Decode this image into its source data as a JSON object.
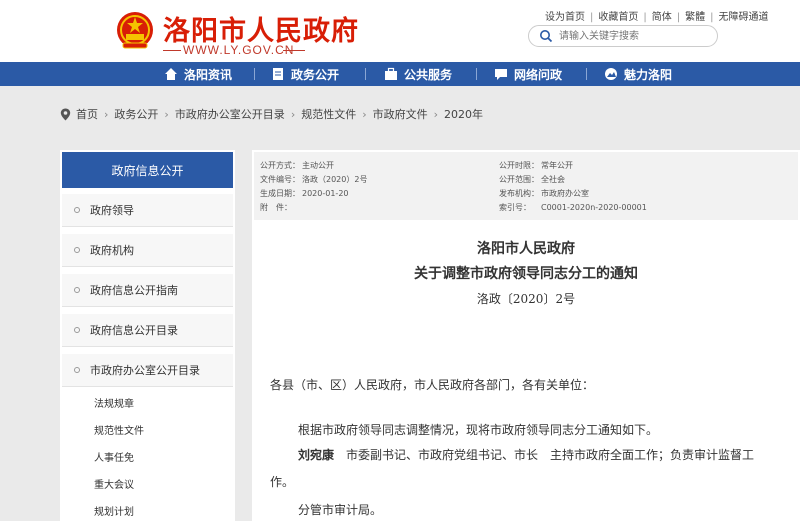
{
  "header": {
    "site_title": "洛阳市人民政府",
    "site_url": "WWW.LY.GOV.CN",
    "top_links": [
      "设为首页",
      "收藏首页",
      "简体",
      "繁體",
      "无障碍通道"
    ],
    "search_placeholder": "请输入关键字搜索"
  },
  "nav": {
    "items": [
      {
        "label": "洛阳资讯",
        "icon": "home-icon"
      },
      {
        "label": "政务公开",
        "icon": "document-icon"
      },
      {
        "label": "公共服务",
        "icon": "briefcase-icon"
      },
      {
        "label": "网络问政",
        "icon": "chat-icon"
      },
      {
        "label": "魅力洛阳",
        "icon": "scenery-icon"
      }
    ]
  },
  "breadcrumb": [
    "首页",
    "政务公开",
    "市政府办公室公开目录",
    "规范性文件",
    "市政府文件",
    "2020年"
  ],
  "sidebar": {
    "title": "政府信息公开",
    "items": [
      "政府领导",
      "政府机构",
      "政府信息公开指南",
      "政府信息公开目录",
      "市政府办公室公开目录"
    ],
    "sub_items": [
      "法规规章",
      "规范性文件",
      "人事任免",
      "重大会议",
      "规划计划"
    ]
  },
  "meta": {
    "left": [
      {
        "key": "公开方式：",
        "value": "主动公开"
      },
      {
        "key": "文件编号：",
        "value": "洛政（2020）2号"
      },
      {
        "key": "生成日期：",
        "value": "2020-01-20"
      },
      {
        "key": "附　件：",
        "value": ""
      }
    ],
    "right": [
      {
        "key": "公开时限：",
        "value": "常年公开"
      },
      {
        "key": "公开范围：",
        "value": "全社会"
      },
      {
        "key": "发布机构：",
        "value": "市政府办公室"
      },
      {
        "key": "索引号：",
        "value": "C0001-2020n-2020-00001"
      }
    ]
  },
  "document": {
    "title_line1": "洛阳市人民政府",
    "title_line2": "关于调整市政府领导同志分工的通知",
    "doc_number": "洛政〔2020〕2号",
    "salutation": "各县（市、区）人民政府，市人民政府各部门，各有关单位：",
    "intro": "根据市政府领导同志调整情况，现将市政府领导同志分工通知如下。",
    "leader_name": "刘宛康",
    "leader_duty_line1": "　市委副书记、市政府党组书记、市长　主持市政府全面工作；负责审计监督工",
    "leader_duty_line2": "作。",
    "leader_manages": "分管市审计局。"
  }
}
